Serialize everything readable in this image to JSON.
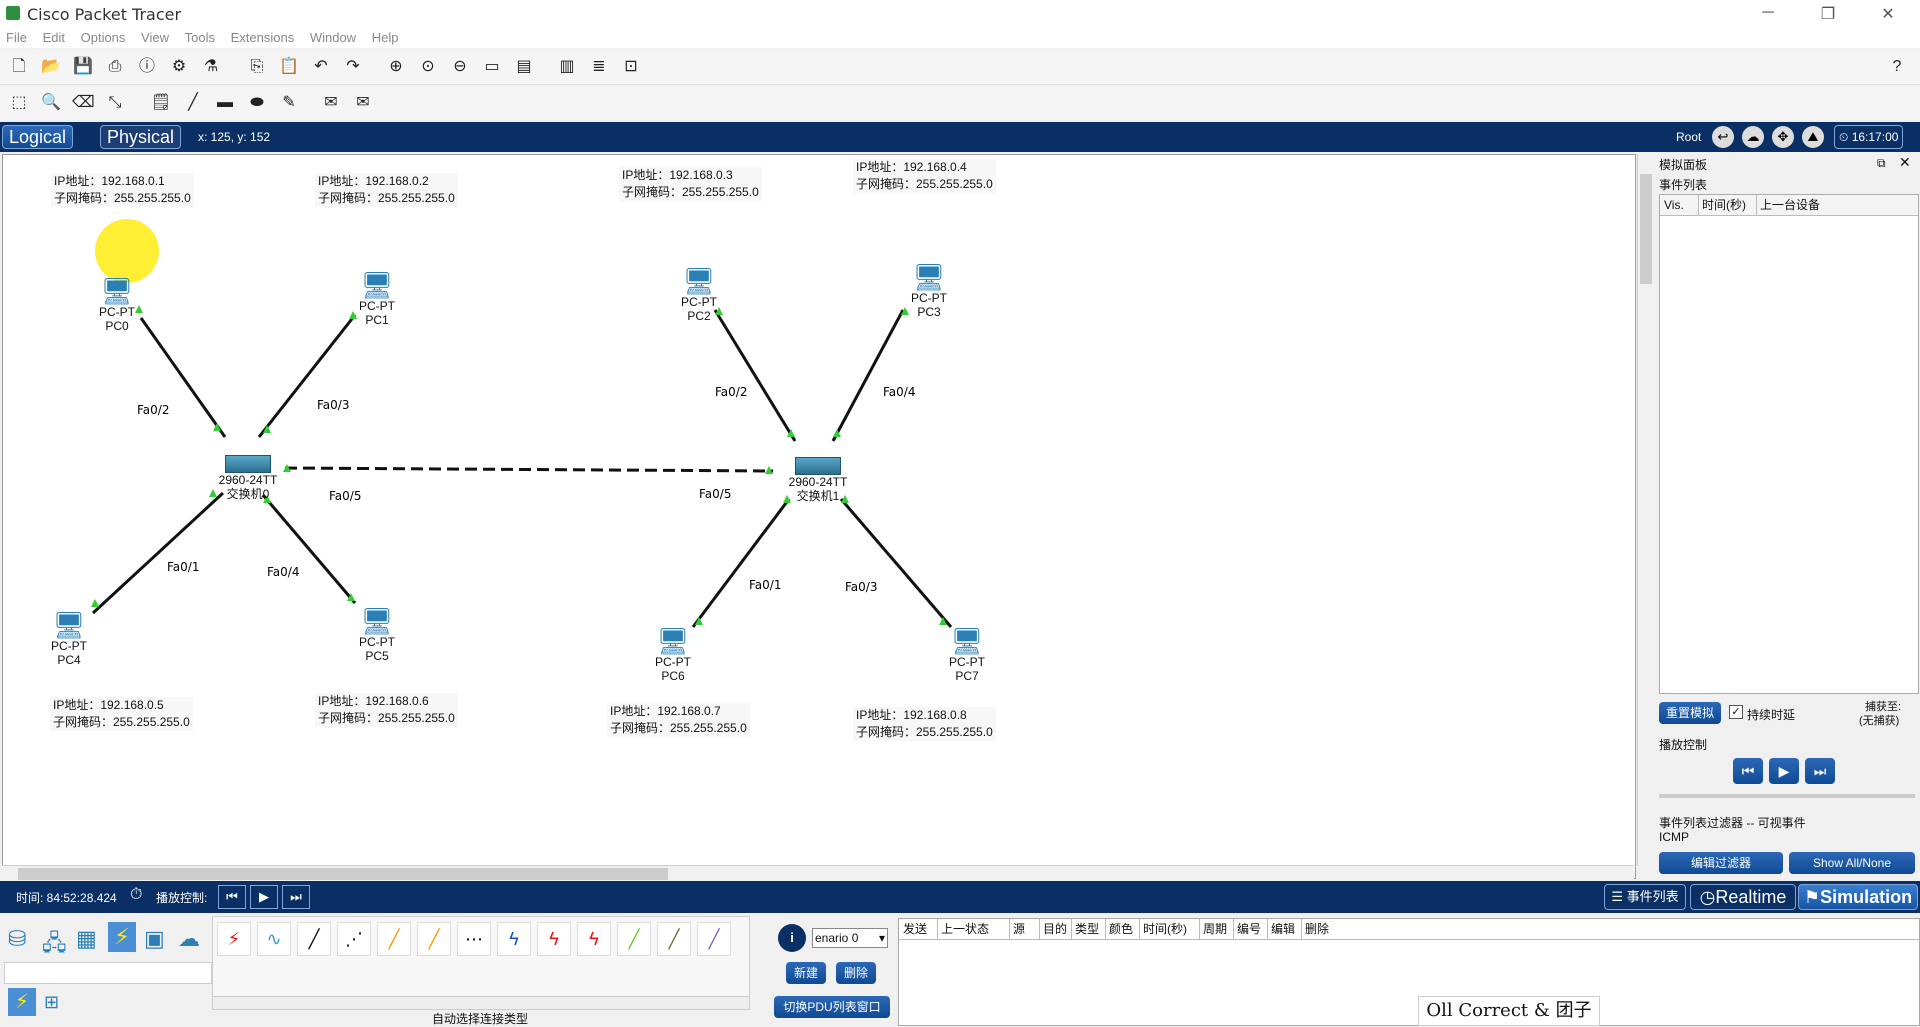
{
  "app": {
    "title": "Cisco Packet Tracer"
  },
  "menu": [
    "File",
    "Edit",
    "Options",
    "View",
    "Tools",
    "Extensions",
    "Window",
    "Help"
  ],
  "mode": {
    "logical": "Logical",
    "physical": "Physical",
    "coords": "x: 125, y: 152",
    "root": "Root",
    "clock": "16:17:00"
  },
  "devices": [
    {
      "type": "PC-PT",
      "name": "PC0"
    },
    {
      "type": "PC-PT",
      "name": "PC1"
    },
    {
      "type": "PC-PT",
      "name": "PC2"
    },
    {
      "type": "PC-PT",
      "name": "PC3"
    },
    {
      "type": "PC-PT",
      "name": "PC4"
    },
    {
      "type": "PC-PT",
      "name": "PC5"
    },
    {
      "type": "PC-PT",
      "name": "PC6"
    },
    {
      "type": "PC-PT",
      "name": "PC7"
    },
    {
      "type": "2960-24TT",
      "name": "交换机0"
    },
    {
      "type": "2960-24TT",
      "name": "交换机1"
    }
  ],
  "ip_notes": [
    {
      "ip": "IP地址：192.168.0.1",
      "mask": "子网掩码：255.255.255.0"
    },
    {
      "ip": "IP地址：192.168.0.2",
      "mask": "子网掩码：255.255.255.0"
    },
    {
      "ip": "IP地址：192.168.0.3",
      "mask": "子网掩码：255.255.255.0"
    },
    {
      "ip": "IP地址：192.168.0.4",
      "mask": "子网掩码：255.255.255.0"
    },
    {
      "ip": "IP地址：192.168.0.5",
      "mask": "子网掩码：255.255.255.0"
    },
    {
      "ip": "IP地址：192.168.0.6",
      "mask": "子网掩码：255.255.255.0"
    },
    {
      "ip": "IP地址：192.168.0.7",
      "mask": "子网掩码：255.255.255.0"
    },
    {
      "ip": "IP地址：192.168.0.8",
      "mask": "子网掩码：255.255.255.0"
    }
  ],
  "ports": [
    "Fa0/2",
    "Fa0/3",
    "Fa0/5",
    "Fa0/1",
    "Fa0/4",
    "Fa0/2",
    "Fa0/4",
    "Fa0/5",
    "Fa0/1",
    "Fa0/3"
  ],
  "sim_panel": {
    "title": "模拟面板",
    "event_list": "事件列表",
    "cols": [
      "Vis.",
      "时间(秒)",
      "上一台设备"
    ],
    "reset": "重置模拟",
    "constant_delay": "持续时延",
    "captured_1": "捕获至:",
    "captured_2": "(无捕获)",
    "playback": "播放控制",
    "filter_title": "事件列表过滤器 -- 可视事件",
    "filter_value": "ICMP",
    "edit_filter": "编辑过滤器",
    "show_all": "Show All/None"
  },
  "bottom": {
    "time": "时间: 84:52:28.424",
    "play_label": "播放控制:",
    "event_list": "事件列表",
    "realtime": "Realtime",
    "simulation": "Simulation",
    "scenario": "enario 0",
    "new": "新建",
    "delete": "删除",
    "toggle_pdu": "切换PDU列表窗口",
    "auto_conn": "自动选择连接类型",
    "pdu_cols": [
      "发送",
      "上一状态",
      "源",
      "目的",
      "类型",
      "颜色",
      "时间(秒)",
      "周期",
      "编号",
      "编辑",
      "删除"
    ],
    "watermark": "Oll Correct & 团子"
  }
}
